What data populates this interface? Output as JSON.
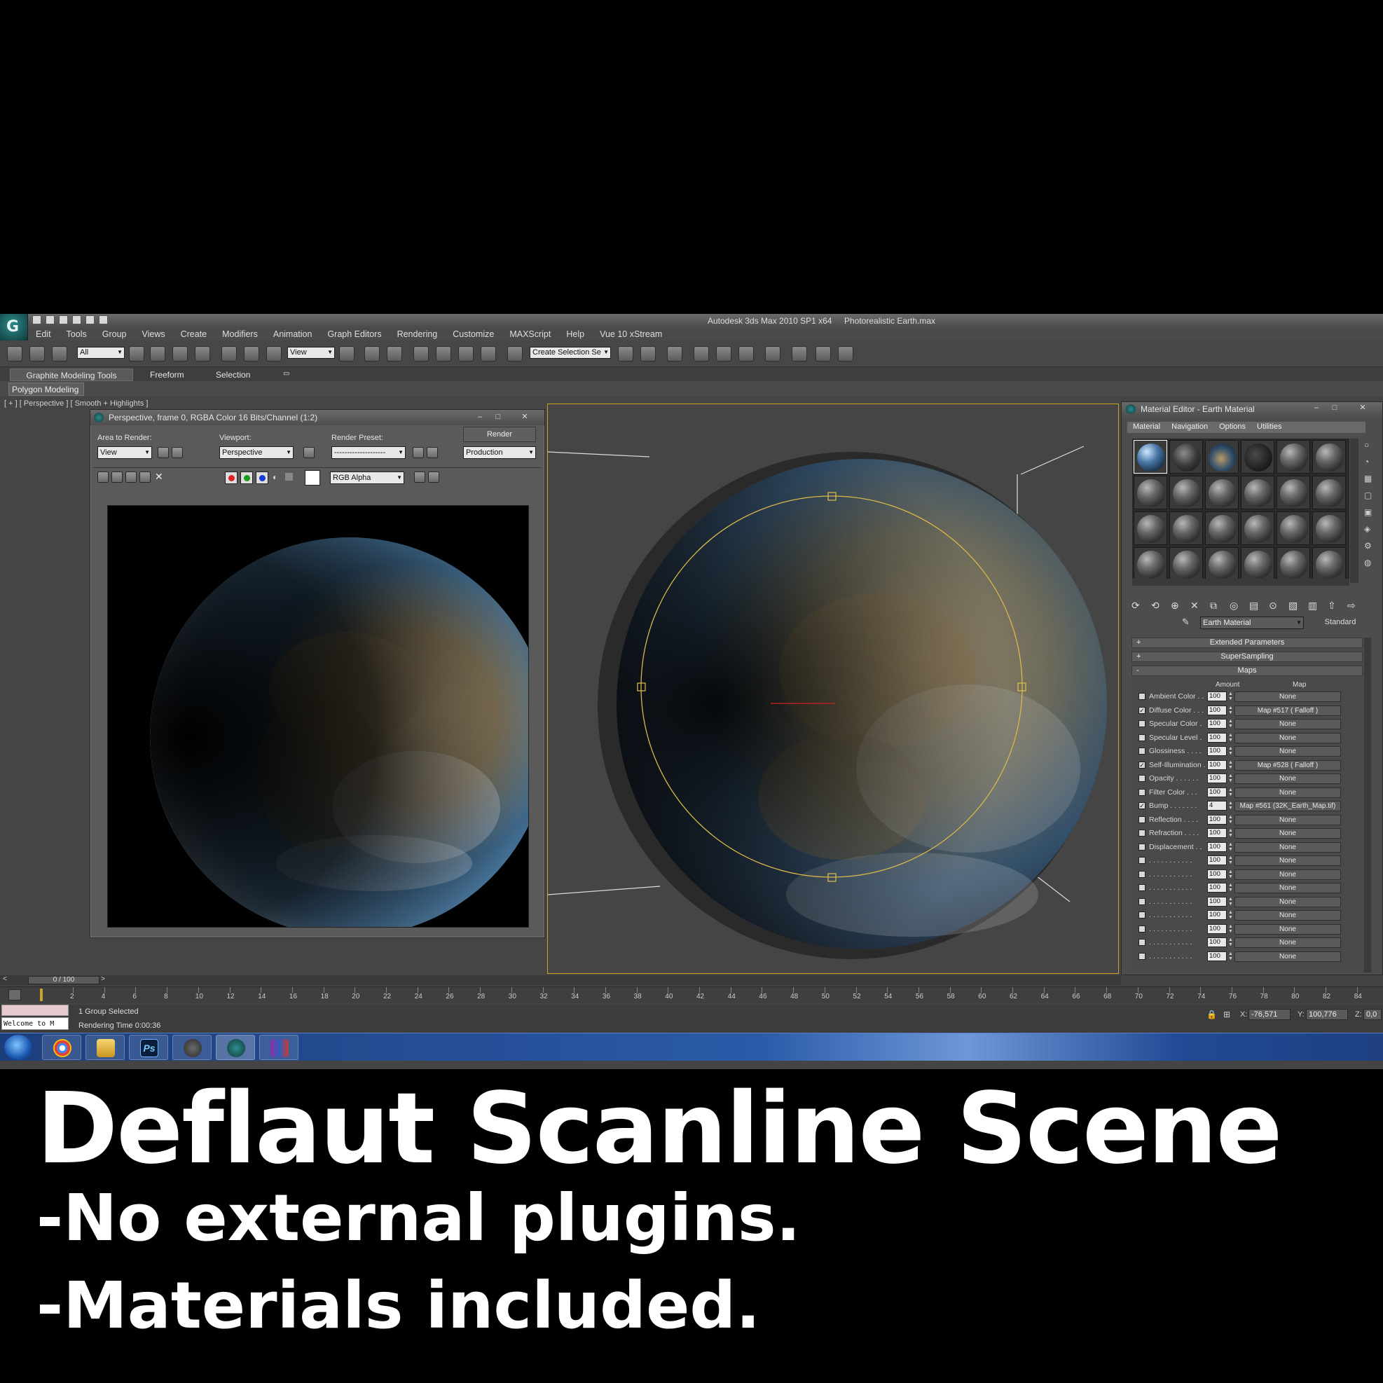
{
  "app": {
    "title": "Autodesk 3ds Max  2010 SP1 x64",
    "filename": "Photorealistic Earth.max",
    "logo_icon": "3ds-max-logo-icon"
  },
  "menu": [
    "Edit",
    "Tools",
    "Group",
    "Views",
    "Create",
    "Modifiers",
    "Animation",
    "Graph Editors",
    "Rendering",
    "Customize",
    "MAXScript",
    "Help",
    "Vue 10 xStream"
  ],
  "toolbar": {
    "selection_filter": "All",
    "ref_coord": "View",
    "named_selection_placeholder": "Create Selection Se"
  },
  "ribbon": {
    "tabs": [
      "Graphite Modeling Tools",
      "Freeform",
      "Selection"
    ],
    "panel": "Polygon Modeling"
  },
  "viewport": {
    "label": "[ + ] [ Perspective ] [ Smooth + Highlights ]"
  },
  "render_window": {
    "title": "Perspective, frame 0, RGBA Color 16 Bits/Channel (1:2)",
    "area_label": "Area to Render:",
    "area_value": "View",
    "viewport_label": "Viewport:",
    "viewport_value": "Perspective",
    "preset_label": "Render Preset:",
    "preset_value": "--------------------",
    "render_button": "Render",
    "mode_value": "Production",
    "channel_value": "RGB Alpha"
  },
  "material_editor": {
    "title": "Material Editor - Earth Material",
    "menu": [
      "Material",
      "Navigation",
      "Options",
      "Utilities"
    ],
    "material_name": "Earth Material",
    "material_type": "Standard",
    "rollouts": {
      "extended": "Extended Parameters",
      "supersampling": "SuperSampling",
      "maps": "Maps"
    },
    "col_amount": "Amount",
    "col_map": "Map",
    "maps": [
      {
        "checked": false,
        "name": "Ambient Color . .",
        "amount": "100",
        "map": "None"
      },
      {
        "checked": true,
        "name": "Diffuse Color . . .",
        "amount": "100",
        "map": "Map #517  ( Falloff )"
      },
      {
        "checked": false,
        "name": "Specular Color  .",
        "amount": "100",
        "map": "None"
      },
      {
        "checked": false,
        "name": "Specular Level  .",
        "amount": "100",
        "map": "None"
      },
      {
        "checked": false,
        "name": "Glossiness  . . . .",
        "amount": "100",
        "map": "None"
      },
      {
        "checked": true,
        "name": "Self-Illumination .",
        "amount": "100",
        "map": "Map #528  ( Falloff )"
      },
      {
        "checked": false,
        "name": "Opacity . . . . . .",
        "amount": "100",
        "map": "None"
      },
      {
        "checked": false,
        "name": "Filter Color  . . .",
        "amount": "100",
        "map": "None"
      },
      {
        "checked": true,
        "name": "Bump  . . . . . . .",
        "amount": "4",
        "map": "Map #561 (32K_Earth_Map.tif)"
      },
      {
        "checked": false,
        "name": "Reflection  . . . .",
        "amount": "100",
        "map": "None"
      },
      {
        "checked": false,
        "name": "Refraction  . . . .",
        "amount": "100",
        "map": "None"
      },
      {
        "checked": false,
        "name": "Displacement  . .",
        "amount": "100",
        "map": "None"
      },
      {
        "checked": false,
        "name": ". . . . . . . . . . .",
        "amount": "100",
        "map": "None"
      },
      {
        "checked": false,
        "name": ". . . . . . . . . . .",
        "amount": "100",
        "map": "None"
      },
      {
        "checked": false,
        "name": ". . . . . . . . . . .",
        "amount": "100",
        "map": "None"
      },
      {
        "checked": false,
        "name": ". . . . . . . . . . .",
        "amount": "100",
        "map": "None"
      },
      {
        "checked": false,
        "name": ". . . . . . . . . . .",
        "amount": "100",
        "map": "None"
      },
      {
        "checked": false,
        "name": ". . . . . . . . . . .",
        "amount": "100",
        "map": "None"
      },
      {
        "checked": false,
        "name": ". . . . . . . . . . .",
        "amount": "100",
        "map": "None"
      },
      {
        "checked": false,
        "name": ". . . . . . . . . . .",
        "amount": "100",
        "map": "None"
      }
    ]
  },
  "timeline": {
    "slider": "0 / 100",
    "ticks": [
      "2",
      "4",
      "6",
      "8",
      "10",
      "12",
      "14",
      "16",
      "18",
      "20",
      "22",
      "24",
      "26",
      "28",
      "30",
      "32",
      "34",
      "36",
      "38",
      "40",
      "42",
      "44",
      "46",
      "48",
      "50",
      "52",
      "54",
      "56",
      "58",
      "60",
      "62",
      "64",
      "66",
      "68",
      "70",
      "72",
      "74",
      "76",
      "78",
      "80",
      "82",
      "84"
    ]
  },
  "status": {
    "listener": "Welcome to M",
    "selection": "1 Group Selected",
    "render_time": "Rendering Time  0:00:36",
    "x_label": "X:",
    "x_value": "-76,571",
    "y_label": "Y:",
    "y_value": "100,776",
    "z_label": "Z:",
    "z_value": "0,0"
  },
  "caption": {
    "title": "Deflaut Scanline Scene",
    "line1": "-No external plugins.",
    "line2": "-Materials included."
  }
}
